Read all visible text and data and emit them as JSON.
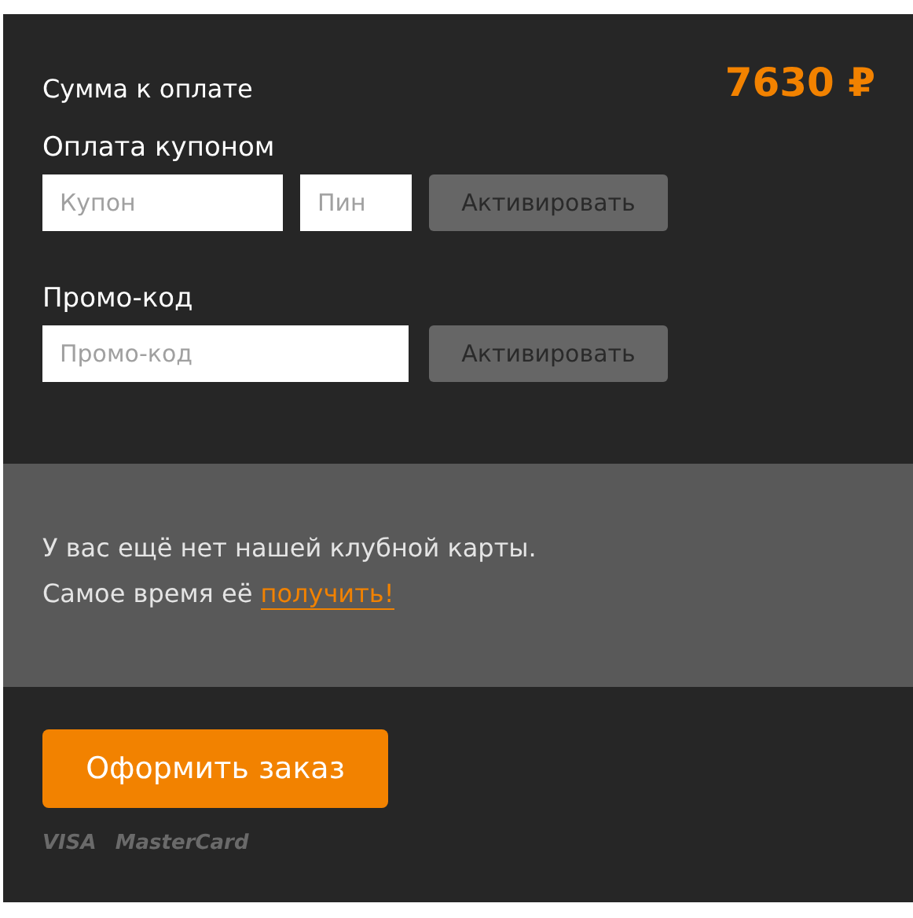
{
  "total": {
    "label": "Сумма к оплате",
    "amount": "7630 ₽"
  },
  "coupon": {
    "title": "Оплата купоном",
    "fields": [
      {
        "placeholder": "Купон"
      },
      {
        "placeholder": "Пин"
      }
    ],
    "button": "Активировать"
  },
  "promo": {
    "title": "Промо-код",
    "fields": [
      {
        "placeholder": "Промо-код"
      }
    ],
    "button": "Активировать"
  },
  "club": {
    "line1": "У вас ещё нет нашей клубной карты.",
    "line2": "Самое время её",
    "link": "получить!"
  },
  "order_button": "Оформить заказ",
  "payment_logos": [
    "VISA",
    "MasterCard"
  ]
}
